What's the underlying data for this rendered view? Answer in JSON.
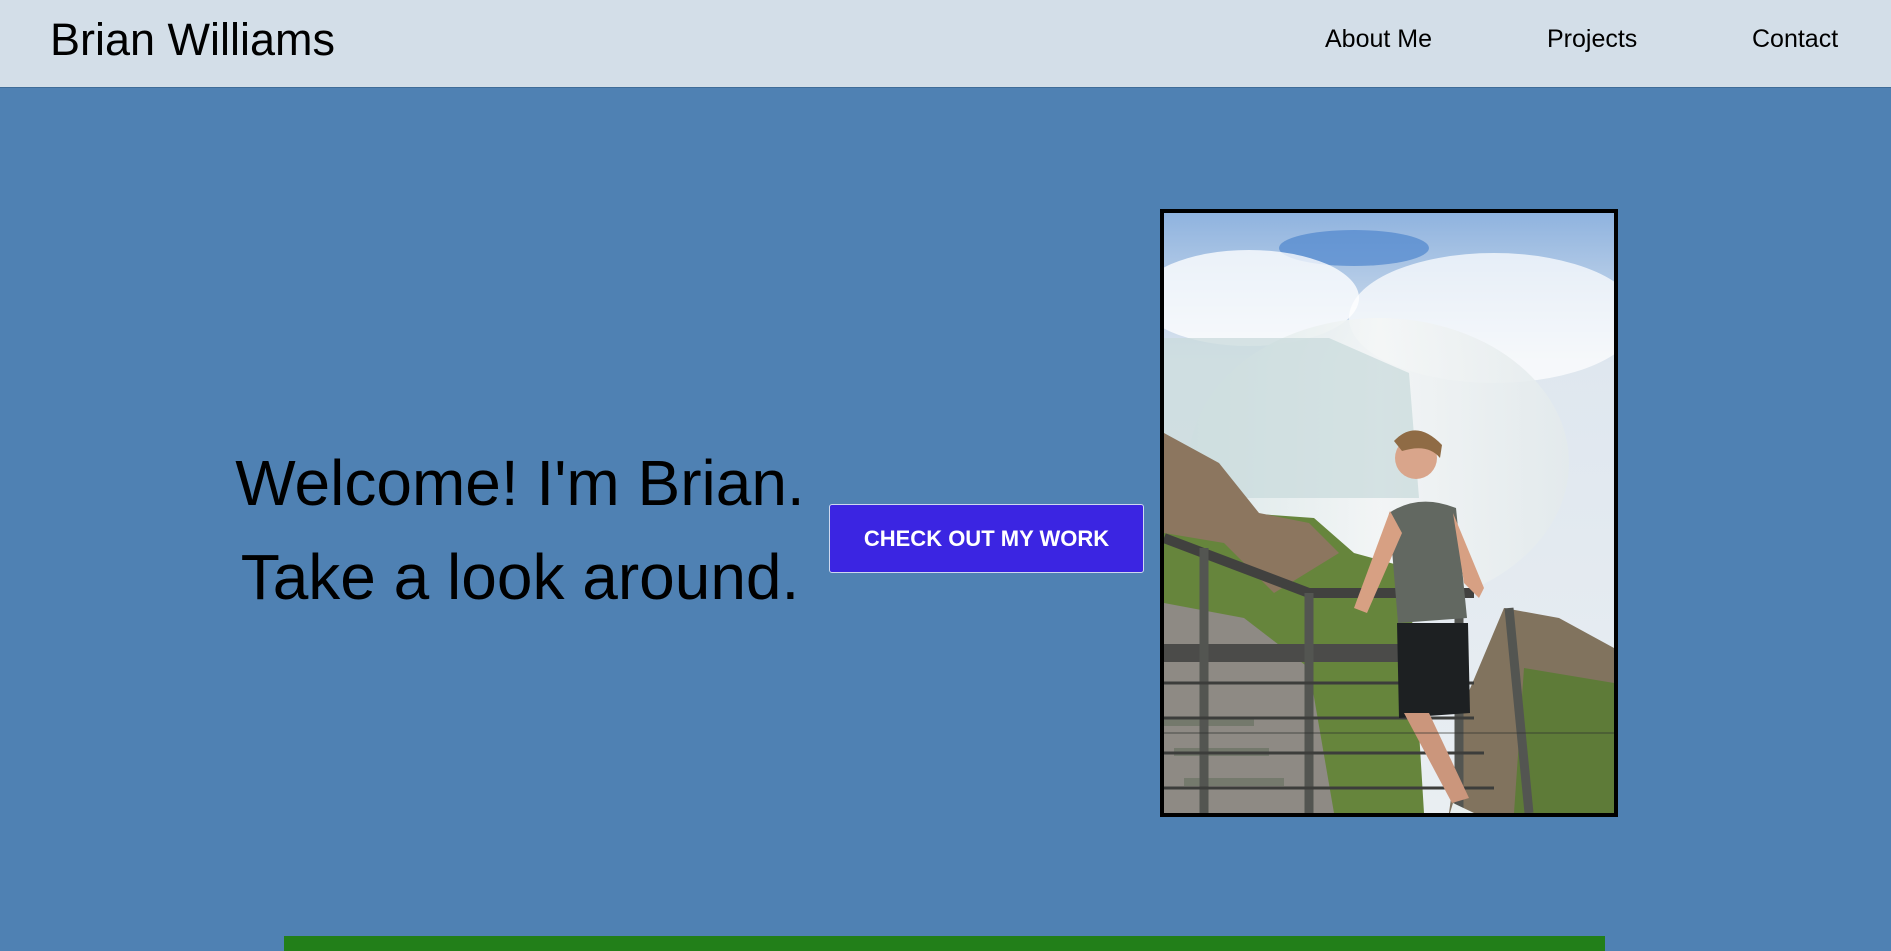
{
  "header": {
    "site_name": "Brian Williams",
    "nav": {
      "about": "About Me",
      "projects": "Projects",
      "contact": "Contact"
    }
  },
  "hero": {
    "line1": "Welcome! I'm Brian.",
    "line2": "Take a look around.",
    "cta_label": "CHECK OUT MY WORK",
    "photo_alt": "Photo of Brian at a waterfall overlook"
  },
  "colors": {
    "nav_background": "#d3dee8",
    "page_background": "#4f81b3",
    "cta_background": "#3b25e2",
    "photo_border": "#000000",
    "green_strip": "#227f19"
  }
}
